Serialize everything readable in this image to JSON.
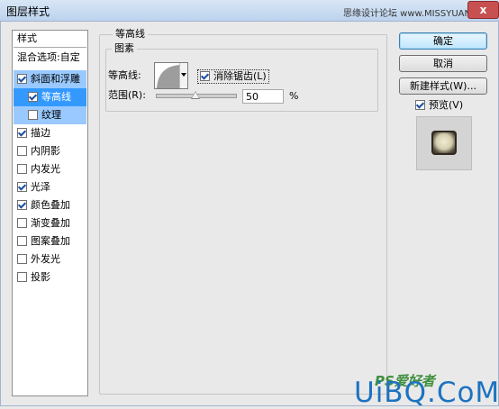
{
  "window": {
    "title": "图层样式",
    "brand": "思缘设计论坛 www.MISSYUAN.COM",
    "close_label": "x"
  },
  "style_list": {
    "header": "样式",
    "blend_options": "混合选项:自定",
    "items": [
      {
        "label": "斜面和浮雕",
        "checked": true
      },
      {
        "label": "等高线",
        "checked": true
      },
      {
        "label": "纹理",
        "checked": false
      },
      {
        "label": "描边",
        "checked": true
      },
      {
        "label": "内阴影",
        "checked": false
      },
      {
        "label": "内发光",
        "checked": false
      },
      {
        "label": "光泽",
        "checked": true
      },
      {
        "label": "颜色叠加",
        "checked": true
      },
      {
        "label": "渐变叠加",
        "checked": false
      },
      {
        "label": "图案叠加",
        "checked": false
      },
      {
        "label": "外发光",
        "checked": false
      },
      {
        "label": "投影",
        "checked": false
      }
    ]
  },
  "panel": {
    "group_title": "等高线",
    "subgroup_title": "图素",
    "contour_label": "等高线:",
    "antialias_label": "消除锯齿(L)",
    "antialias_checked": true,
    "range_label": "范围(R):",
    "range_value": "50",
    "range_unit": "%",
    "range_slider_level": 50
  },
  "buttons": {
    "ok": "确定",
    "cancel": "取消",
    "new_style": "新建样式(W)...",
    "preview_label": "预览(V)",
    "preview_checked": true
  },
  "watermark": {
    "small": "PS爱好者",
    "main": "UiBQ.CoM"
  }
}
